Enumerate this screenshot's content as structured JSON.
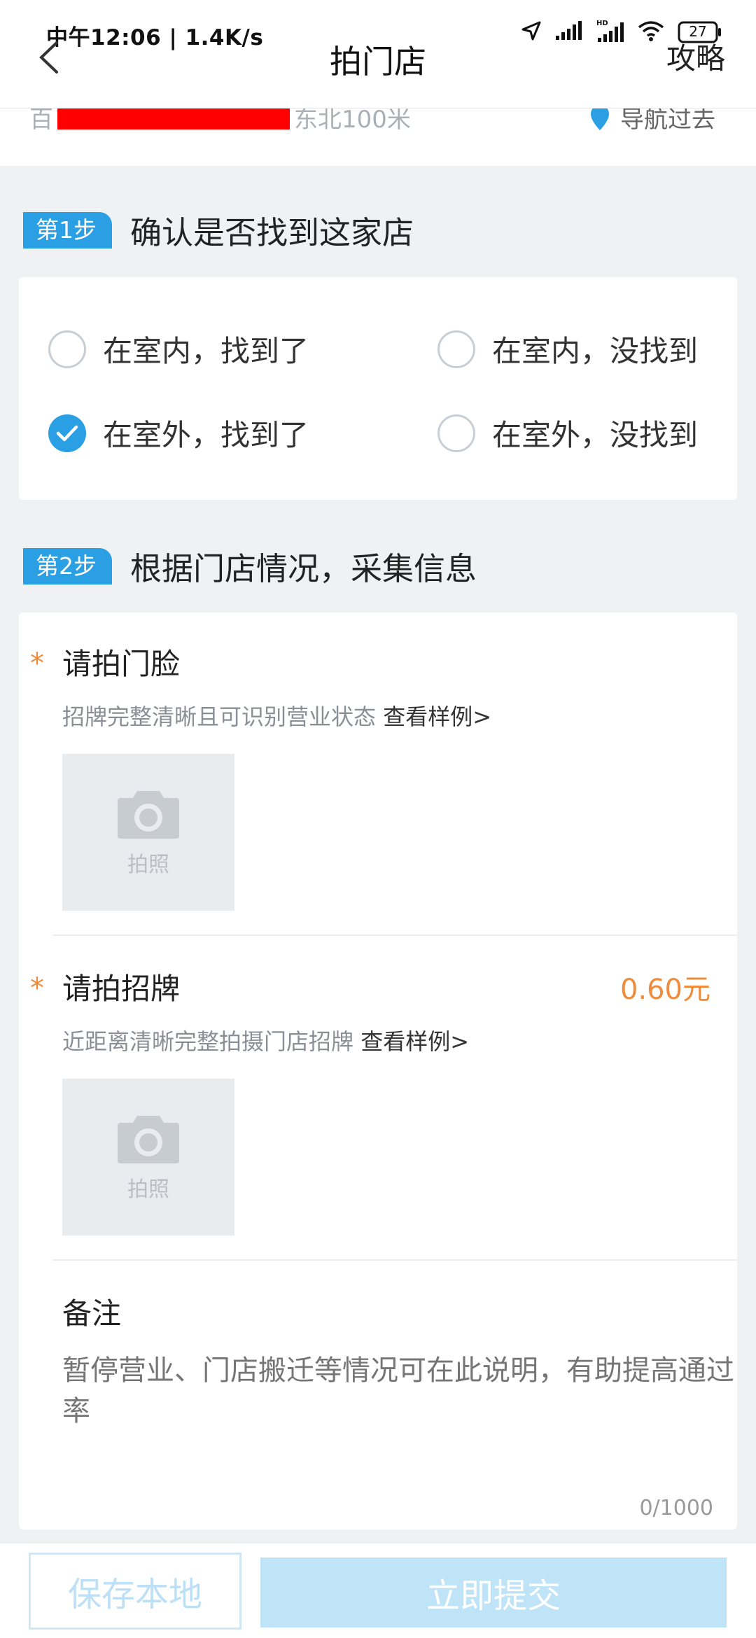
{
  "status_bar": {
    "time": "中午12:06 | 1.4K/s",
    "battery": "27"
  },
  "header": {
    "title": "拍门店",
    "guide": "攻略"
  },
  "address": {
    "text_prefix": "百",
    "text_suffix": "东北100米",
    "nav_label": "导航过去"
  },
  "step1": {
    "badge": "第1步",
    "title": "确认是否找到这家店",
    "options": [
      {
        "label": "在室内，找到了",
        "checked": false
      },
      {
        "label": "在室内，没找到",
        "checked": false
      },
      {
        "label": "在室外，找到了",
        "checked": true
      },
      {
        "label": "在室外，没找到",
        "checked": false
      }
    ]
  },
  "step2": {
    "badge": "第2步",
    "title": "根据门店情况，采集信息",
    "fields": [
      {
        "required": "*",
        "title": "请拍门脸",
        "hint": "招牌完整清晰且可识别营业状态",
        "sample_link": "查看样例>",
        "photo_label": "拍照"
      },
      {
        "required": "*",
        "title": "请拍招牌",
        "reward": "0.60元",
        "hint": "近距离清晰完整拍摄门店招牌",
        "sample_link": "查看样例>",
        "photo_label": "拍照"
      }
    ],
    "remark": {
      "title": "备注",
      "placeholder": "暂停营业、门店搬迁等情况可在此说明，有助提高通过率",
      "counter": "0/1000"
    }
  },
  "bottom": {
    "save_label": "保存本地",
    "submit_label": "立即提交"
  },
  "colors": {
    "accent": "#2b9fe4",
    "reward": "#ef8c3c",
    "disabled_submit": "#bfe3f7"
  }
}
